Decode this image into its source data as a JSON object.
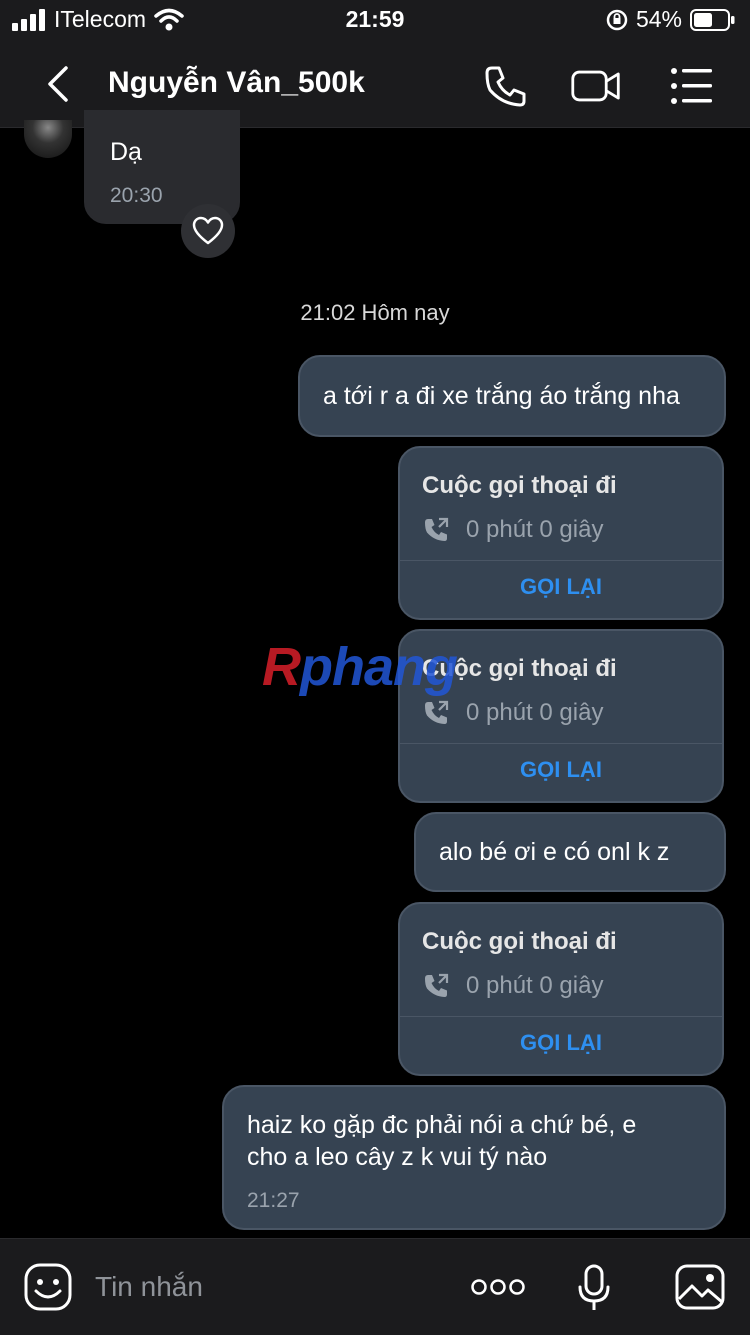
{
  "status_bar": {
    "carrier": "ITelecom",
    "time": "21:59",
    "battery": "54%"
  },
  "header": {
    "contact_name": "Nguyễn Vân_500k"
  },
  "messages": {
    "incoming_1": {
      "text": "Dạ",
      "time": "20:30"
    },
    "separator": "21:02 Hôm nay",
    "out_1": {
      "text": "a tới r a đi xe trắng áo trắng nha"
    },
    "call_1": {
      "title": "Cuộc gọi thoại đi",
      "duration": "0 phút 0 giây",
      "action": "GỌI LẠI"
    },
    "call_2": {
      "title": "Cuộc gọi thoại đi",
      "duration": "0 phút 0 giây",
      "action": "GỌI LẠI"
    },
    "out_2": {
      "text": "alo bé ơi e có onl k z"
    },
    "call_3": {
      "title": "Cuộc gọi thoại đi",
      "duration": "0 phút 0 giây",
      "action": "GỌI LẠI"
    },
    "out_3": {
      "line1": "haiz ko gặp đc phải nói a chứ bé, e",
      "line2": "cho a leo cây z k vui tý nào",
      "time": "21:27"
    }
  },
  "watermark": {
    "part1": "R",
    "part2": "phang"
  },
  "composer": {
    "placeholder": "Tin nhắn"
  },
  "colors": {
    "accent": "#2e8ff0",
    "bubble_out": "#364352",
    "bubble_in": "#2a2b2f",
    "bar": "#1b1b1d"
  }
}
